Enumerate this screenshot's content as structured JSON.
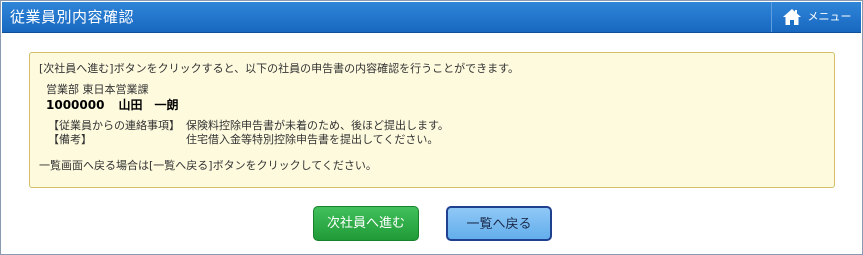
{
  "header": {
    "title": "従業員別内容確認",
    "menu_label": "メニュー",
    "menu_icon": "home-icon"
  },
  "info": {
    "intro": "[次社員へ進む]ボタンをクリックすると、以下の社員の申告書の内容確認を行うことができます。",
    "department": "営業部 東日本営業課",
    "employee_id": "1000000",
    "employee_name": "山田　一朗",
    "contact_label": "【従業員からの連絡事項】",
    "contact_value": "保険料控除申告書が未着のため、後ほど提出します。",
    "remarks_label": "【備考】",
    "remarks_value": "住宅借入金等特別控除申告書を提出してください。",
    "back_note": "一覧画面へ戻る場合は[一覧へ戻る]ボタンをクリックしてください。"
  },
  "buttons": {
    "next_label": "次社員へ進む",
    "back_label": "一覧へ戻る"
  },
  "colors": {
    "header": "#1f74cc",
    "info_bg": "#fdfade",
    "info_border": "#d6bd6c",
    "next_button": "#2eaa47",
    "back_button": "#79bcf1"
  }
}
